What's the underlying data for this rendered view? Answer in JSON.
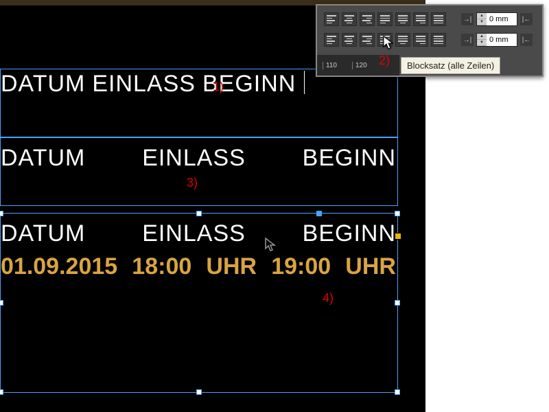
{
  "panel": {
    "indent1_value": "0 mm",
    "indent2_value": "0 mm",
    "ruler_a": "110",
    "ruler_b": "120",
    "tooltip": "Blocksatz (alle Zeilen)"
  },
  "annotations": {
    "a1": "1)",
    "a2": "2)",
    "a3": "3)",
    "a4": "4)"
  },
  "frame1": {
    "w1": "DATUM",
    "w2": "EINLASS",
    "w3": "BEGINN"
  },
  "frame2": {
    "c1": "DATUM",
    "c2": "EINLASS",
    "c3": "BEGINN"
  },
  "frame3": {
    "r1": {
      "c1": "DATUM",
      "c2": "EINLASS",
      "c3": "BEGINN"
    },
    "r2": {
      "c1": "01.09.2015",
      "c2": "18:00",
      "c3": "UHR",
      "c4": "19:00",
      "c5": "UHR"
    }
  }
}
